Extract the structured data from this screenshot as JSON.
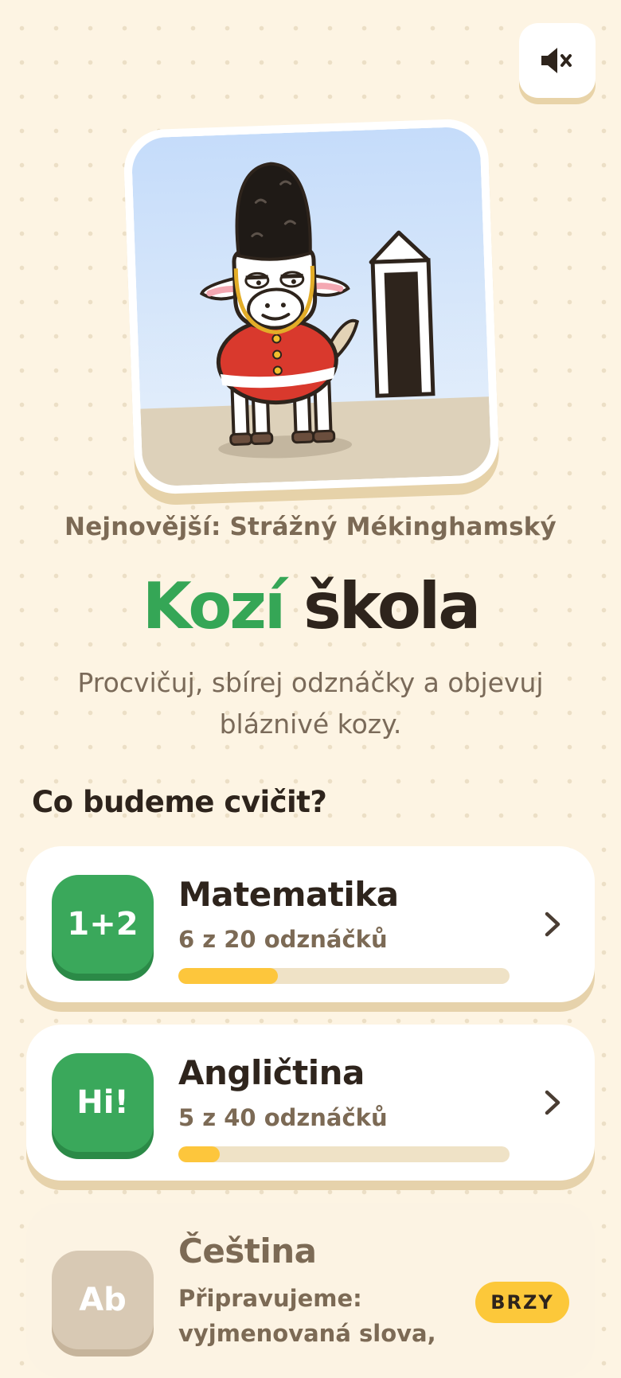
{
  "mute_button": {
    "icon": "speaker-mute-icon"
  },
  "hero": {
    "caption": "Nejnovější: Strážný Mékinghamský"
  },
  "title": {
    "part1": "Kozí",
    "part2": "škola"
  },
  "subtitle": "Procvičuj, sbírej odznáčky a objevuj bláznivé kozy.",
  "section_heading": "Co budeme cvičit?",
  "subjects": [
    {
      "icon_text": "1+2",
      "name": "Matematika",
      "progress_text": "6 z 20 odznáčků",
      "progress": 0.3
    },
    {
      "icon_text": "Hi!",
      "name": "Angličtina",
      "progress_text": "5 z 40 odznáčků",
      "progress": 0.125
    },
    {
      "icon_text": "Ab",
      "name": "Čeština",
      "coming_text": "Připravujeme: vyjmenovaná slova,",
      "badge": "BRZY"
    }
  ],
  "colors": {
    "accent_green": "#35a656",
    "progress_yellow": "#fdc63c",
    "background": "#fdf4e3"
  }
}
